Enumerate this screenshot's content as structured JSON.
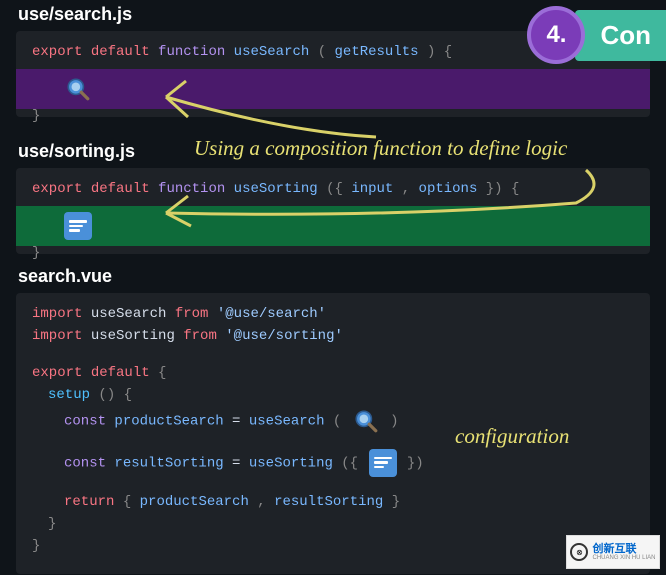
{
  "step": {
    "number": "4.",
    "label": "Con"
  },
  "annotations": {
    "composition": "Using a composition function to define logic",
    "configuration": "configuration"
  },
  "files": {
    "file1": {
      "name": "use/search.js",
      "line1_export": "export",
      "line1_default": "default",
      "line1_function": "function",
      "line1_fn": "useSearch",
      "line1_open": "(",
      "line1_param": "getResults",
      "line1_close": ") {",
      "line_end": "}"
    },
    "file2": {
      "name": "use/sorting.js",
      "line1_export": "export",
      "line1_default": "default",
      "line1_function": "function",
      "line1_fn": "useSorting",
      "line1_open": "({ ",
      "line1_p1": "input",
      "line1_comma": ", ",
      "line1_p2": "options",
      "line1_close": " }) {",
      "line_end": "}"
    },
    "file3": {
      "name": "search.vue",
      "l1_import": "import",
      "l1_name": " useSearch ",
      "l1_from": "from",
      "l1_str": " '@use/search'",
      "l2_import": "import",
      "l2_name": " useSorting ",
      "l2_from": "from",
      "l2_str": " '@use/sorting'",
      "l3_export": "export",
      "l3_default": "default",
      "l3_brace": " {",
      "l4_setup": "setup",
      "l4_paren": "() {",
      "l5_const": "const",
      "l5_var": " productSearch",
      "l5_eq": " = ",
      "l5_call": "useSearch",
      "l5_open": "( ",
      "l5_close": "  )",
      "l6_const": "const",
      "l6_var": " resultSorting",
      "l6_eq": " = ",
      "l6_call": "useSorting",
      "l6_open": "({ ",
      "l6_close": "  })",
      "l7_return": "return",
      "l7_open": " { ",
      "l7_v1": "productSearch",
      "l7_comma": ", ",
      "l7_v2": "resultSorting",
      "l7_close": " }",
      "l8_close": "}",
      "l9_close": "}"
    }
  },
  "watermark": {
    "cn": "创新互联",
    "en": "CHUANG XIN HU LIAN"
  }
}
